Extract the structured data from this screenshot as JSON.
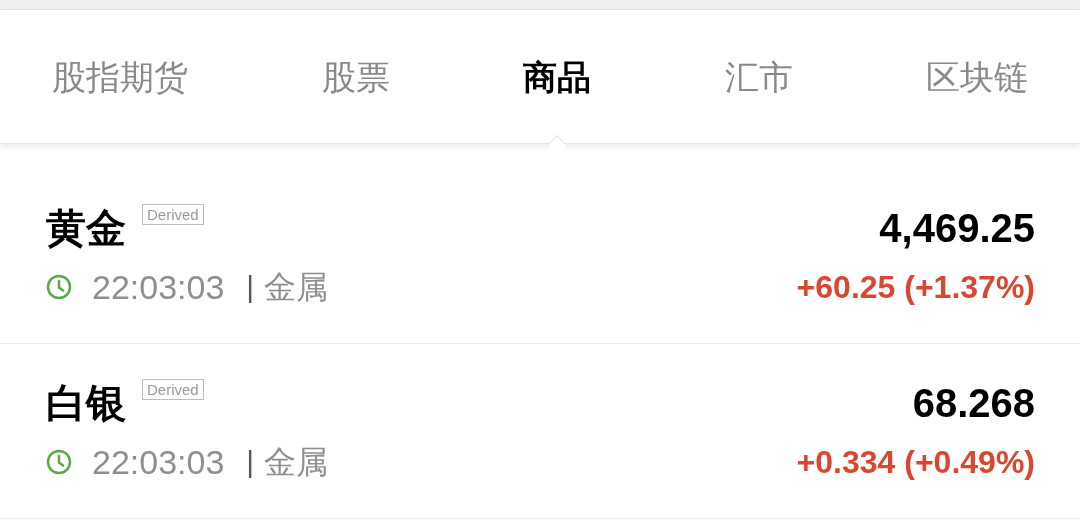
{
  "tabs": [
    {
      "label": "股指期货",
      "selected": false
    },
    {
      "label": "股票",
      "selected": false
    },
    {
      "label": "商品",
      "selected": true
    },
    {
      "label": "汇市",
      "selected": false
    },
    {
      "label": "区块链",
      "selected": false
    }
  ],
  "quotes": [
    {
      "name": "黄金",
      "tag": "Derived",
      "time": "22:03:03",
      "separator": "|",
      "category": "金属",
      "price": "4,469.25",
      "change": "+60.25 (+1.37%)"
    },
    {
      "name": "白银",
      "tag": "Derived",
      "time": "22:03:03",
      "separator": "|",
      "category": "金属",
      "price": "68.268",
      "change": "+0.334 (+0.49%)"
    }
  ]
}
